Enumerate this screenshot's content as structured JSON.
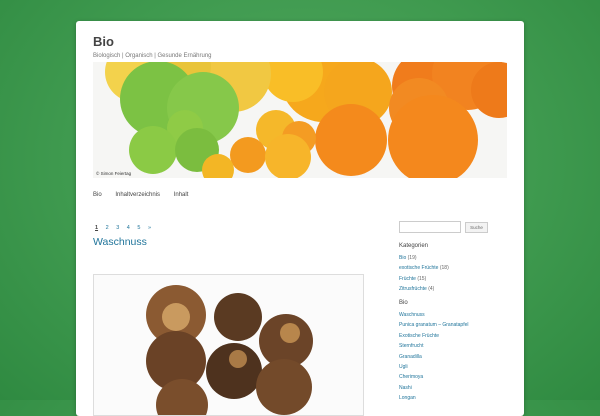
{
  "site": {
    "title": "Bio",
    "description": "Biologisch | Organisch | Gesunde Ernährung"
  },
  "header_image": {
    "credit": "© Simon Feiertag"
  },
  "nav": {
    "items": [
      "Bio",
      "Inhaltverzeichnis",
      "Inhalt"
    ]
  },
  "pagination": {
    "pages": [
      "1",
      "2",
      "3",
      "4",
      "5"
    ],
    "next": "»",
    "current": "1"
  },
  "post": {
    "title": "Waschnuss"
  },
  "sidebar": {
    "search_placeholder": "",
    "search_button": "Suche",
    "categories_title": "Kategorien",
    "categories": [
      {
        "label": "Bio",
        "count": "(19)"
      },
      {
        "label": "exotische Früchte",
        "count": "(18)"
      },
      {
        "label": "Früchte",
        "count": "(15)"
      },
      {
        "label": "Zitrusfrüchte",
        "count": "(4)"
      }
    ],
    "bio_title": "Bio",
    "bio_links": [
      "Waschnuss",
      "Punica granatum – Granatapfel",
      "Exotische Früchte",
      "Sternfrucht",
      "Granadilla",
      "Ugli",
      "Cherimoya",
      "Nashi",
      "Longan"
    ]
  },
  "colors": {
    "background": "#3f9a4f",
    "link": "#21759b",
    "text": "#444444"
  }
}
